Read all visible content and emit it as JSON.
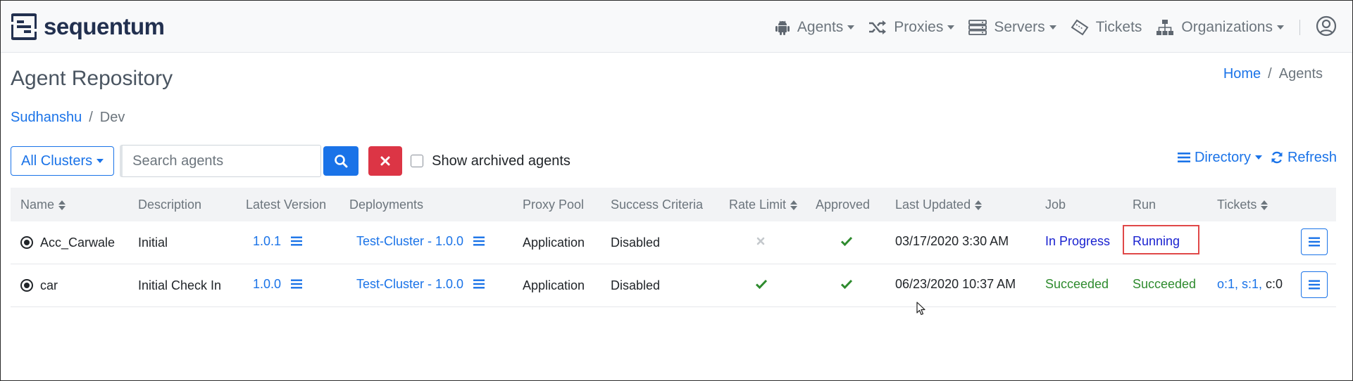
{
  "brand": {
    "name": "sequentum"
  },
  "nav": {
    "agents": "Agents",
    "proxies": "Proxies",
    "servers": "Servers",
    "tickets": "Tickets",
    "organizations": "Organizations"
  },
  "page": {
    "title": "Agent Repository",
    "breadcrumb_home": "Home",
    "breadcrumb_current": "Agents",
    "path_parent": "Sudhanshu",
    "path_current": "Dev"
  },
  "toolbar": {
    "clusters_label": "All Clusters",
    "search_placeholder": "Search agents",
    "show_archived_label": "Show archived agents",
    "directory_label": "Directory",
    "refresh_label": "Refresh"
  },
  "table": {
    "headers": {
      "name": "Name",
      "description": "Description",
      "latest_version": "Latest Version",
      "deployments": "Deployments",
      "proxy_pool": "Proxy Pool",
      "success_criteria": "Success Criteria",
      "rate_limit": "Rate Limit",
      "approved": "Approved",
      "last_updated": "Last Updated",
      "job": "Job",
      "run": "Run",
      "tickets": "Tickets"
    },
    "rows": [
      {
        "name": "Acc_Carwale",
        "description": "Initial",
        "version": "1.0.1",
        "deployment": "Test-Cluster - 1.0.0",
        "proxy_pool": "Application",
        "success_criteria": "Disabled",
        "rate_limit": false,
        "approved": true,
        "last_updated": "03/17/2020 3:30 AM",
        "job": "In Progress",
        "run": "Running",
        "tickets": {
          "o": "",
          "s": "",
          "c": ""
        }
      },
      {
        "name": "car",
        "description": "Initial Check In",
        "version": "1.0.0",
        "deployment": "Test-Cluster - 1.0.0",
        "proxy_pool": "Application",
        "success_criteria": "Disabled",
        "rate_limit": true,
        "approved": true,
        "last_updated": "06/23/2020 10:37 AM",
        "job": "Succeeded",
        "run": "Succeeded",
        "tickets": {
          "o": "o:1,",
          "s": "s:1,",
          "c": "c:0"
        }
      }
    ]
  },
  "colors": {
    "primary": "#1a73e8",
    "danger": "#dc3545",
    "success": "#2e8b2e",
    "running": "#1a22d0",
    "highlight": "#e04848",
    "brand": "#22304f"
  },
  "icons": {
    "agents": "android-icon",
    "proxies": "shuffle-icon",
    "servers": "server-icon",
    "tickets": "ticket-icon",
    "organizations": "sitemap-icon",
    "account": "user-circle-icon"
  }
}
